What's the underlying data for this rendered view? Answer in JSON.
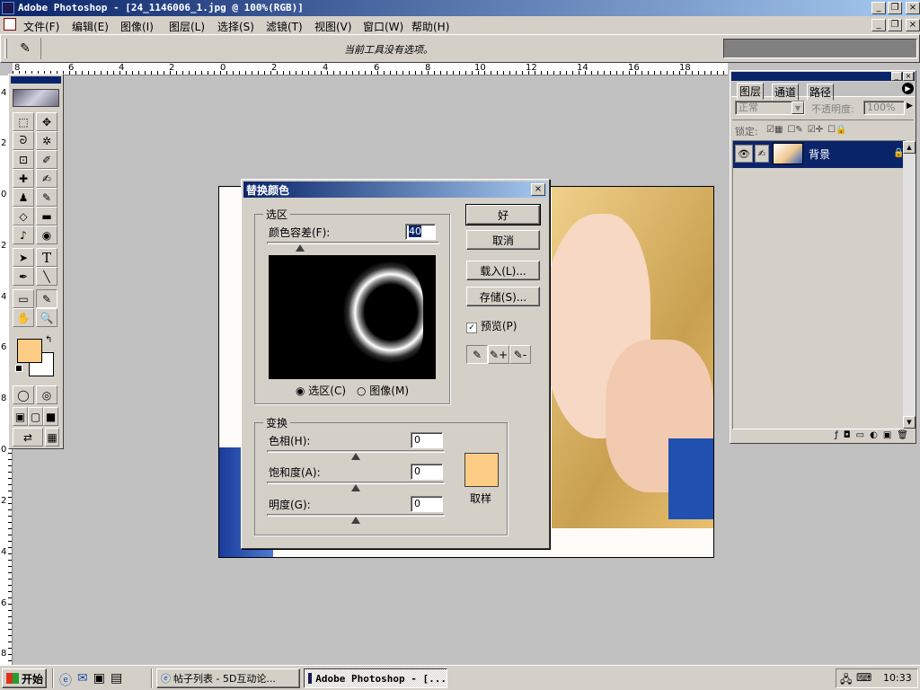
{
  "app_title": "Adobe Photoshop - [24_1146006_1.jpg @ 100%(RGB)]",
  "menu": [
    "文件(F)",
    "编辑(E)",
    "图像(I)",
    "图层(L)",
    "选择(S)",
    "滤镜(T)",
    "视图(V)",
    "窗口(W)",
    "帮助(H)"
  ],
  "options_bar": {
    "message": "当前工具没有选项。"
  },
  "ruler": {
    "h_labels": [
      "8",
      "6",
      "4",
      "2",
      "0",
      "2",
      "4",
      "6",
      "8",
      "10",
      "12",
      "14",
      "16",
      "18"
    ],
    "v_labels": [
      "4",
      "2",
      "0",
      "2",
      "4",
      "6",
      "8",
      "0",
      "2",
      "4",
      "6",
      "8"
    ]
  },
  "dialog": {
    "title": "替换颜色",
    "selection_group": "选区",
    "fuzziness_label": "颜色容差(F):",
    "fuzziness_value": "40",
    "radio_selection": "选区(C)",
    "radio_image": "图像(M)",
    "ok": "好",
    "cancel": "取消",
    "load": "载入(L)...",
    "save": "存储(S)...",
    "preview": "预览(P)",
    "transform_group": "变换",
    "hue_label": "色相(H):",
    "hue_value": "0",
    "saturation_label": "饱和度(A):",
    "saturation_value": "0",
    "lightness_label": "明度(G):",
    "lightness_value": "0",
    "sample_label": "取样",
    "sample_color": "#fecd85"
  },
  "layers_panel": {
    "tabs": [
      "图层",
      "通道",
      "路径"
    ],
    "blend_mode": "正常",
    "opacity_label": "不透明度:",
    "opacity_value": "100%",
    "lock_label": "锁定:",
    "layer_name": "背景"
  },
  "colors": {
    "foreground": "#fecd85",
    "background": "#ffffff",
    "title_bar": "#0a246a",
    "layer_selected": "#0a246a"
  },
  "taskbar": {
    "start": "开始",
    "tasks": [
      "帖子列表 - 5D互动论...",
      "Adobe Photoshop - [..."
    ],
    "clock": "10:33"
  }
}
